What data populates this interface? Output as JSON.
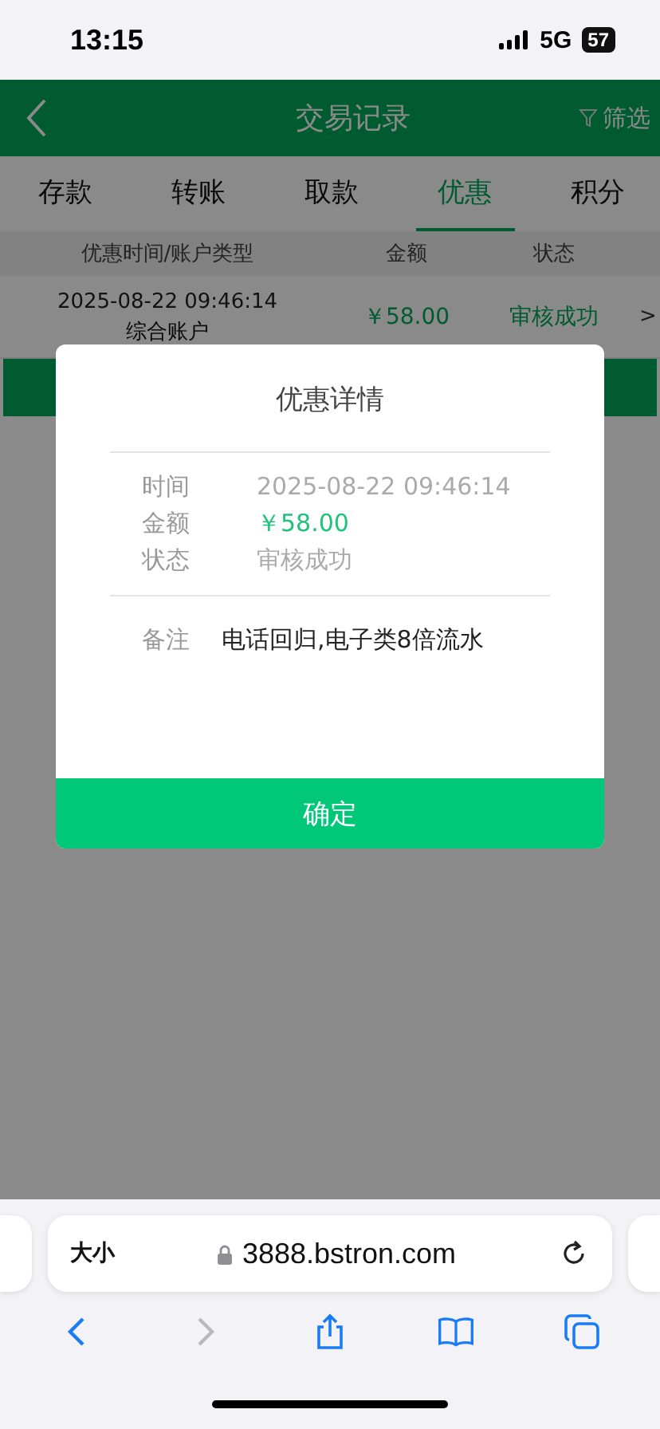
{
  "status_bar": {
    "time": "13:15",
    "network": "5G",
    "battery": "57"
  },
  "header": {
    "title": "交易记录",
    "filter": "筛选"
  },
  "tabs": [
    {
      "label": "存款",
      "selected": false
    },
    {
      "label": "转账",
      "selected": false
    },
    {
      "label": "取款",
      "selected": false
    },
    {
      "label": "优惠",
      "selected": true
    },
    {
      "label": "积分",
      "selected": false
    }
  ],
  "table": {
    "columns": [
      "优惠时间/账户类型",
      "金额",
      "状态"
    ],
    "rows": [
      {
        "time": "2025-08-22 09:46:14",
        "account": "综合账户",
        "amount": "￥58.00",
        "status": "审核成功",
        "arrow": ">"
      }
    ]
  },
  "dialog": {
    "title": "优惠详情",
    "fields": [
      {
        "label": "时间",
        "value": "2025-08-22 09:46:14",
        "kind": "plain"
      },
      {
        "label": "金额",
        "value": "￥58.00",
        "kind": "money"
      },
      {
        "label": "状态",
        "value": "审核成功",
        "kind": "plain"
      }
    ],
    "note": {
      "label": "备注",
      "value": "电话回归,电子类8倍流水"
    },
    "button": "确定"
  },
  "browser": {
    "text_size": "大小",
    "url": "3888.bstron.com"
  }
}
